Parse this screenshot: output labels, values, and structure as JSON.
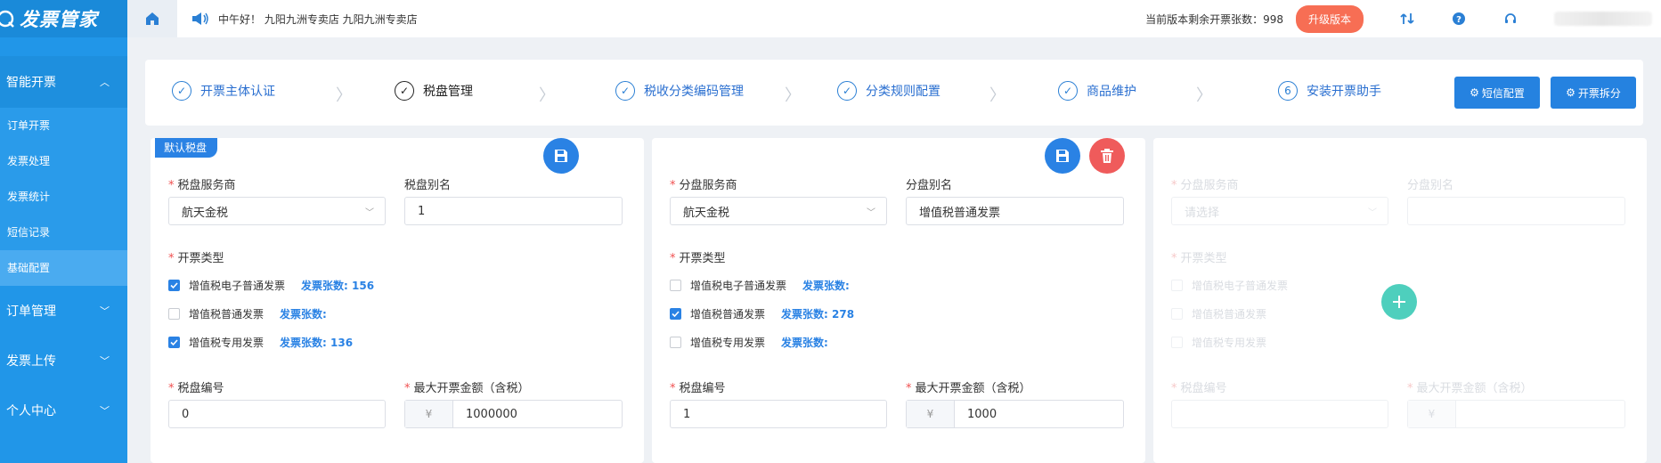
{
  "app": {
    "name": "发票管家",
    "home_icon": "home-icon",
    "speaker_icon": "speaker-icon"
  },
  "sidebar": {
    "groups": [
      {
        "label": "智能开票",
        "open": true,
        "items": [
          {
            "label": "订单开票",
            "active": false
          },
          {
            "label": "发票处理",
            "active": false
          },
          {
            "label": "发票统计",
            "active": false
          },
          {
            "label": "短信记录",
            "active": false
          },
          {
            "label": "基础配置",
            "active": true
          }
        ]
      },
      {
        "label": "订单管理",
        "open": false
      },
      {
        "label": "发票上传",
        "open": false
      },
      {
        "label": "个人中心",
        "open": false
      }
    ]
  },
  "header": {
    "greeting": "中午好！ 九阳九洲专卖店 九阳九洲专卖店",
    "remaining_label": "当前版本剩余开票张数：",
    "remaining_count": "998",
    "upgrade_label": "升级版本",
    "icons": [
      "switch-icon",
      "help-icon",
      "headset-icon"
    ]
  },
  "steps": [
    {
      "label": "开票主体认证",
      "marker": "✓",
      "current": false
    },
    {
      "label": "税盘管理",
      "marker": "✓",
      "current": true
    },
    {
      "label": "税收分类编码管理",
      "marker": "✓",
      "current": false
    },
    {
      "label": "分类规则配置",
      "marker": "✓",
      "current": false
    },
    {
      "label": "商品维护",
      "marker": "✓",
      "current": false
    },
    {
      "label": "安装开票助手",
      "marker": "6",
      "current": false
    }
  ],
  "actions": {
    "sms_config": "短信配置",
    "split_invoice": "开票拆分"
  },
  "cards": [
    {
      "tag": "默认税盘",
      "provider_label": "税盘服务商",
      "provider_value": "航天金税",
      "alias_label": "税盘别名",
      "alias_value": "1",
      "type_label": "开票类型",
      "types": [
        {
          "name": "增值税电子普通发票",
          "checked": true,
          "count_label": "发票张数:",
          "count": "156"
        },
        {
          "name": "增值税普通发票",
          "checked": false,
          "count_label": "发票张数:",
          "count": ""
        },
        {
          "name": "增值税专用发票",
          "checked": true,
          "count_label": "发票张数:",
          "count": "136"
        }
      ],
      "number_label": "税盘编号",
      "number_value": "0",
      "max_label": "最大开票金额（含税）",
      "currency": "¥",
      "max_value": "1000000"
    },
    {
      "provider_label": "分盘服务商",
      "provider_value": "航天金税",
      "alias_label": "分盘别名",
      "alias_value": "增值税普通发票",
      "type_label": "开票类型",
      "types": [
        {
          "name": "增值税电子普通发票",
          "checked": false,
          "count_label": "发票张数:",
          "count": ""
        },
        {
          "name": "增值税普通发票",
          "checked": true,
          "count_label": "发票张数:",
          "count": "278"
        },
        {
          "name": "增值税专用发票",
          "checked": false,
          "count_label": "发票张数:",
          "count": ""
        }
      ],
      "number_label": "税盘编号",
      "number_value": "1",
      "max_label": "最大开票金额（含税）",
      "currency": "¥",
      "max_value": "1000"
    },
    {
      "provider_label": "分盘服务商",
      "provider_placeholder": "请选择",
      "alias_label": "分盘别名",
      "type_label": "开票类型",
      "types": [
        {
          "name": "增值税电子普通发票"
        },
        {
          "name": "增值税普通发票"
        },
        {
          "name": "增值税专用发票"
        }
      ],
      "number_label": "税盘编号",
      "max_label": "最大开票金额（含税）",
      "currency": "¥"
    }
  ],
  "colors": {
    "sidebar": "#2196e8",
    "primary": "#2a82e4",
    "danger": "#ef5b5b",
    "add": "#4ecfbd",
    "upgrade": "#f76e54"
  }
}
